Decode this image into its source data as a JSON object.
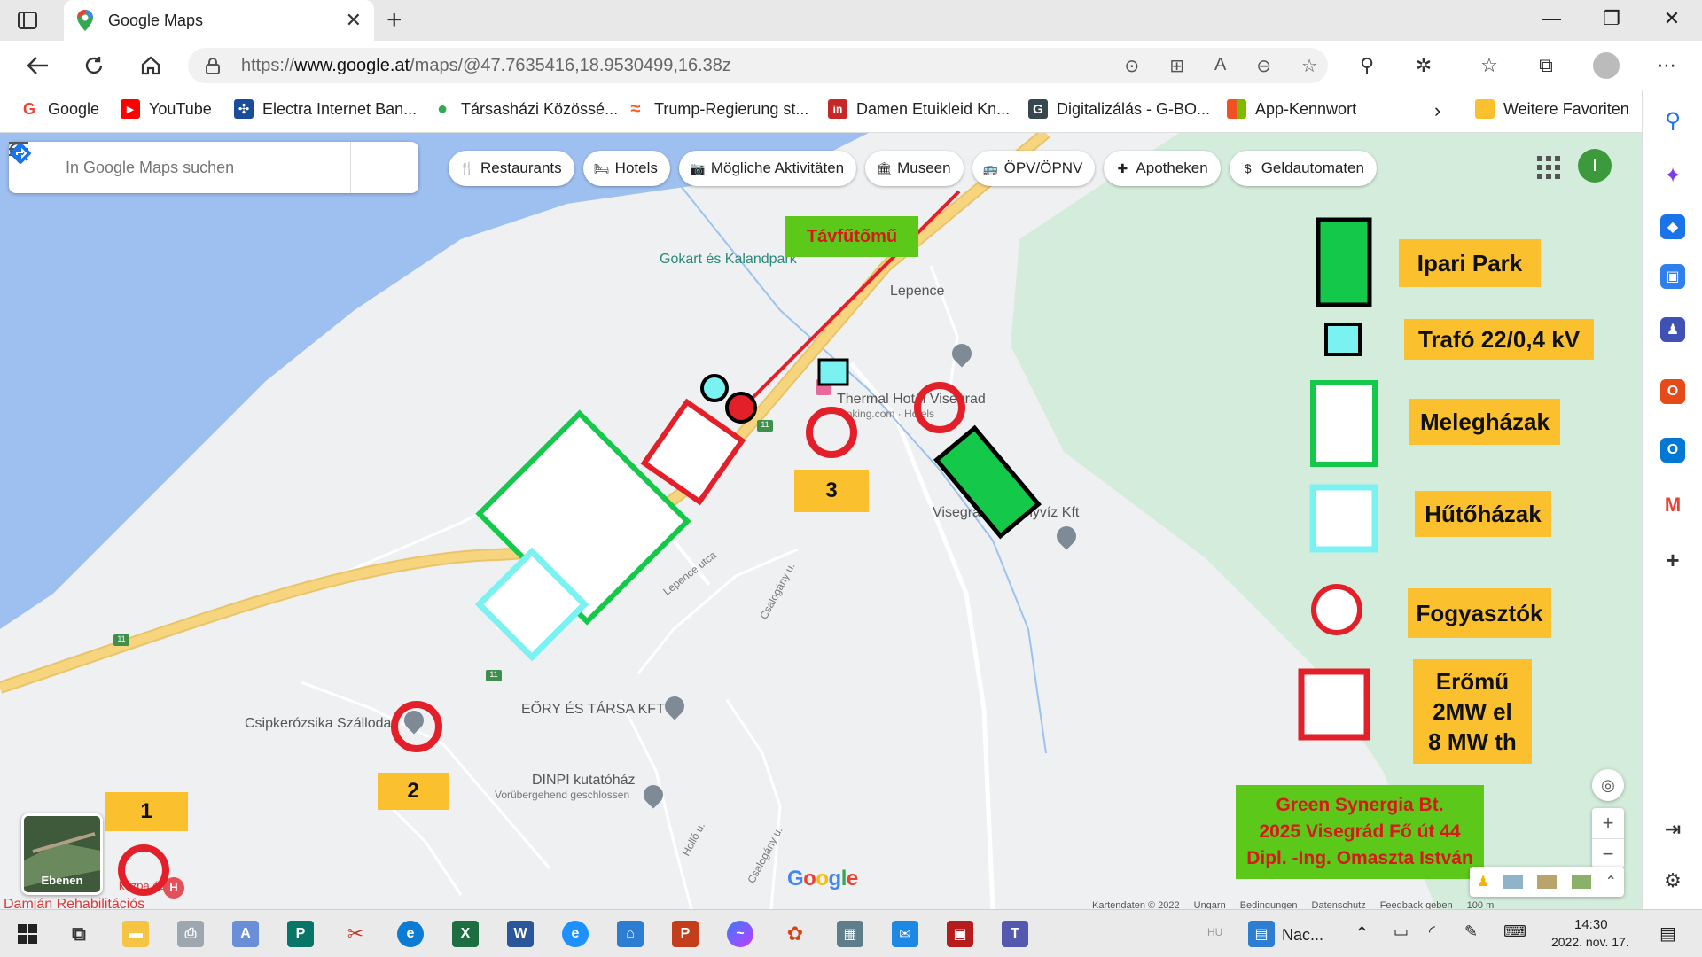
{
  "browser": {
    "tab_title": "Google Maps",
    "url_prefix": "https://",
    "url_host": "www.google.at",
    "url_path": "/maps/@47.7635416,18.9530499,16.38z",
    "favorites": [
      {
        "label": "Google",
        "icon": "G",
        "color": "#4285f4"
      },
      {
        "label": "YouTube",
        "icon": "▶",
        "color": "#ff0000"
      },
      {
        "label": "Electra Internet Ban...",
        "icon": "✣",
        "color": "#1a4c9c"
      },
      {
        "label": "Társasházi Közössé...",
        "icon": "●",
        "color": "#34a853"
      },
      {
        "label": "Trump-Regierung st...",
        "icon": "≈",
        "color": "#ff5722"
      },
      {
        "label": "Damen Etuikleid Kn...",
        "icon": "in",
        "color": "#c62828"
      },
      {
        "label": "Digitalizálás - G-BO...",
        "icon": "G",
        "color": "#37474f"
      },
      {
        "label": "App-Kennwort",
        "icon": "▦",
        "color": "#f25022"
      }
    ],
    "more_favorites": "Weitere Favoriten"
  },
  "maps": {
    "search_placeholder": "In Google Maps suchen",
    "chips": [
      {
        "label": "Restaurants",
        "icon": "fork-knife-icon",
        "glyph": "🍴"
      },
      {
        "label": "Hotels",
        "icon": "bed-icon",
        "glyph": "🛏"
      },
      {
        "label": "Mögliche Aktivitäten",
        "icon": "camera-icon",
        "glyph": "📷"
      },
      {
        "label": "Museen",
        "icon": "museum-icon",
        "glyph": "🏛"
      },
      {
        "label": "ÖPV/ÖPNV",
        "icon": "bus-icon",
        "glyph": "🚌"
      },
      {
        "label": "Apotheken",
        "icon": "pharmacy-icon",
        "glyph": "✚"
      },
      {
        "label": "Geldautomaten",
        "icon": "atm-icon",
        "glyph": "$"
      }
    ],
    "profile_initial": "I",
    "places": {
      "gokart": "Gokart és Kalandpark",
      "lepence": "Lepence",
      "thermal": "Thermal Hotel Visegrad",
      "thermal_sub": "ooking.com · Hotels",
      "visegrad_ásvány": "Visegrá",
      "visegrad_ásvány2": "nyvíz Kft",
      "csipke": "Csipkerózsika Szálloda",
      "eory": "EŐRY ÉS TÁRSA KFT",
      "dinpi": "DINPI kutatóház",
      "dinpi_sub": "Vorübergehend geschlossen",
      "damjan": "Damján Rehabilitációs",
      "damjan2": "kozpa és",
      "lepence_utca": "Lepence utca",
      "csalogany1": "Csalogány u.",
      "csalogany2": "Csalogány u.",
      "hollo": "Holló u.",
      "route11": "11"
    },
    "layers_label": "Ebenen",
    "google_logo": "Google",
    "attribution": [
      "Kartendaten © 2022",
      "Ungarn",
      "Bedingungen",
      "Datenschutz",
      "Feedback geben",
      "100 m"
    ]
  },
  "annotations": {
    "tavfutomu": "Távfűtőmű",
    "num1": "1",
    "num2": "2",
    "num3": "3",
    "legend": [
      {
        "label": "Ipari Park"
      },
      {
        "label": "Trafó 22/0,4 kV"
      },
      {
        "label": "Melegházak"
      },
      {
        "label": "Hűtőházak"
      },
      {
        "label": "Fogyasztók"
      },
      {
        "label_lines": [
          "Erőmű",
          "2MW el",
          "8 MW th"
        ]
      }
    ],
    "company": [
      "Green Synergia Bt.",
      "2025 Visegrád Fő út 44",
      "Dipl. -Ing. Omaszta István"
    ]
  },
  "taskbar": {
    "tray_text": "Nac...",
    "time": "14:30",
    "date": "2022. nov. 17.",
    "lang": "HU"
  },
  "colors": {
    "water": "#9ec0f0",
    "green_area": "#d4ecdc",
    "road": "#f7d57e",
    "red": "#e3202a",
    "green": "#14c84a",
    "cyan": "#7af2f2",
    "yellow": "#fbc02d",
    "label_green": "#5cc91a"
  }
}
